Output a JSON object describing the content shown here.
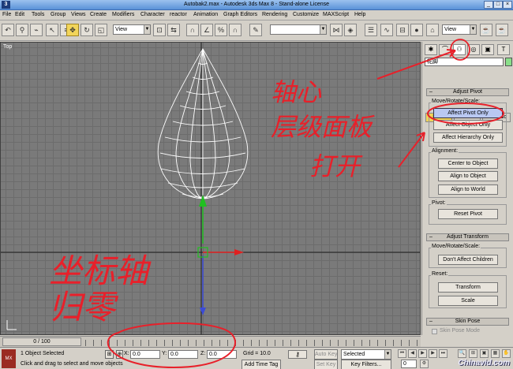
{
  "window": {
    "title": "Autobak2.max - Autodesk 3ds Max 8 - Stand-alone License",
    "app_icon": "3ds-max-logo-icon",
    "controls": [
      "minimize-icon",
      "maximize-icon",
      "close-icon"
    ]
  },
  "menu": [
    "File",
    "Edit",
    "Tools",
    "Group",
    "Views",
    "Create",
    "Modifiers",
    "Character",
    "reactor",
    "Animation",
    "Graph Editors",
    "Rendering",
    "Customize",
    "MAXScript",
    "Help"
  ],
  "toolbar": {
    "reference_coord": "View",
    "selection_set": "",
    "right_view": "View",
    "active_tool": "select-and-move-icon"
  },
  "viewport": {
    "label": "Top",
    "model": "teardrop wireframe",
    "colors": {
      "background": "#7a7a7a",
      "grid": "#6c6c6c",
      "wireframe": "#ffffff",
      "axis_x": "#e02020",
      "axis_y": "#20c020"
    }
  },
  "command_panel": {
    "tabs": [
      "create-icon",
      "modify-icon",
      "hierarchy-icon",
      "motion-icon",
      "display-icon",
      "utilities-icon"
    ],
    "active_tab": "hierarchy-icon",
    "object_name": "花脚",
    "object_color": "#8adf8a",
    "subtabs": [
      "Pivot",
      "IK",
      "Link Info"
    ],
    "active_subtab": "Pivot",
    "adjust_pivot": {
      "rollout": "Adjust Pivot",
      "move_group": "Move/Rotate/Scale:",
      "affect_pivot_only": "Affect Pivot Only",
      "affect_object_only": "Affect Object Only",
      "affect_hierarchy_only": "Affect Hierarchy Only",
      "alignment_group": "Alignment:",
      "center_to_object": "Center to Object",
      "align_to_object": "Align to Object",
      "align_to_world": "Align to World",
      "pivot_group": "Pivot:",
      "reset_pivot": "Reset Pivot"
    },
    "adjust_transform": {
      "rollout": "Adjust Transform",
      "move_group": "Move/Rotate/Scale:",
      "dont_affect_children": "Don't Affect Children",
      "reset_group": "Reset:",
      "transform": "Transform",
      "scale": "Scale"
    },
    "skin_pose": {
      "rollout": "Skin Pose",
      "skin_pose_mode": "Skin Pose Mode"
    }
  },
  "timeline": {
    "frame": "0 / 100"
  },
  "status": {
    "selected": "1 Object Selected",
    "prompt": "Click and drag to select and move objects",
    "x_label": "X:",
    "x": "0.0",
    "y_label": "Y:",
    "y": "0.0",
    "z_label": "Z:",
    "z": "0.0",
    "grid": "Grid = 10.0",
    "auto_key": "Auto Key",
    "set_key": "Set Key",
    "selected_combo": "Selected",
    "key_filters": "Key Filters...",
    "add_time_tag": "Add Time Tag",
    "frame_field": "0"
  },
  "annotations": {
    "line1": "轴心",
    "line2": "层级面板",
    "line3": "打开",
    "line4": "坐标轴",
    "line5": "归零",
    "color": "#e8202a"
  },
  "watermark": "Chinavid.com"
}
